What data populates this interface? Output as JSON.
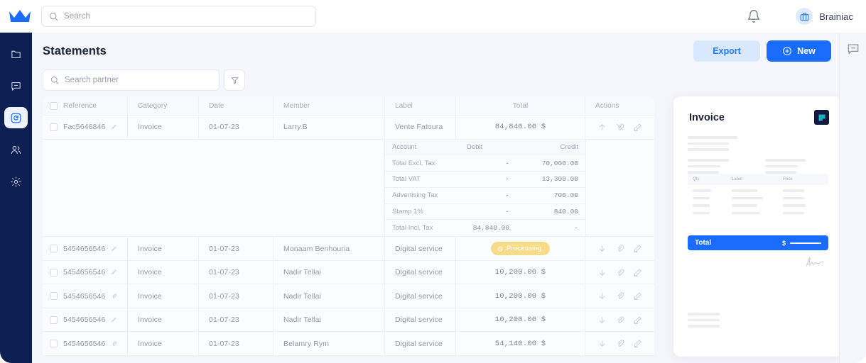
{
  "topbar": {
    "logo": "crown-logo",
    "search_placeholder": "Search",
    "bell": "bell-icon",
    "avatar_icon": "briefcase-icon",
    "user_name": "Brainiac"
  },
  "sidebar": {
    "items": [
      {
        "icon": "folder-icon",
        "active": false
      },
      {
        "icon": "chat-minus-icon",
        "active": false
      },
      {
        "icon": "sync-refresh-icon",
        "active": true
      },
      {
        "icon": "users-icon",
        "active": false
      },
      {
        "icon": "settings-gear-icon",
        "active": false
      }
    ]
  },
  "header": {
    "title": "Statements",
    "export_label": "Export",
    "new_label": "New"
  },
  "toolbar": {
    "search_placeholder": "Search partner",
    "filter_icon": "funnel-filter-icon"
  },
  "table": {
    "columns": [
      "Reference",
      "Category",
      "Date",
      "Member",
      "Label",
      "Total",
      "Actions"
    ],
    "rows": [
      {
        "reference": "Fac5646846",
        "ref_icon": "magic-wand-icon",
        "category": "Invoice",
        "date": "01-07-23",
        "member": "Larry.B",
        "label": "Vente Fatoura",
        "total": "84,840.00 $",
        "status": null,
        "actions": [
          "arrow-up-icon",
          "paperclip-slash-icon",
          "pencil-icon"
        ],
        "expanded": true
      },
      {
        "reference": "5454656546",
        "ref_icon": "magic-wand-icon",
        "category": "Invoice",
        "date": "01-07-23",
        "member": "Monaam Benhouria",
        "label": "Digital service",
        "total": null,
        "status": "Processing",
        "actions": [
          "arrow-down-icon",
          "paperclip-icon",
          "pencil-icon"
        ],
        "expanded": false
      },
      {
        "reference": "5454656546",
        "ref_icon": "magic-wand-icon",
        "category": "Invoice",
        "date": "01-07-23",
        "member": "Nadir Tellai",
        "label": "Digital service",
        "total": "10,200.00 $",
        "status": null,
        "actions": [
          "arrow-down-icon",
          "paperclip-icon",
          "pencil-icon"
        ],
        "expanded": false
      },
      {
        "reference": "5454656546",
        "ref_icon": "paperclip-icon",
        "category": "Invoice",
        "date": "01-07-23",
        "member": "Nadir Tellai",
        "label": "Digital service",
        "total": "10,200.00 $",
        "status": null,
        "actions": [
          "arrow-down-icon",
          "paperclip-icon",
          "pencil-icon"
        ],
        "expanded": false
      },
      {
        "reference": "5454656546",
        "ref_icon": "magic-wand-icon",
        "category": "Invoice",
        "date": "01-07-23",
        "member": "Nadir Tellai",
        "label": "Digital service",
        "total": "10,200.00 $",
        "status": null,
        "actions": [
          "arrow-down-icon",
          "paperclip-icon",
          "pencil-icon"
        ],
        "expanded": false
      },
      {
        "reference": "5454656546",
        "ref_icon": "paperclip-icon",
        "category": "Invoice",
        "date": "01-07-23",
        "member": "Belamry Rym",
        "label": "Digital service",
        "total": "54,140.00 $",
        "status": null,
        "actions": [
          "arrow-down-icon",
          "paperclip-icon",
          "pencil-icon"
        ],
        "expanded": false
      }
    ]
  },
  "subtable": {
    "columns": [
      "Account",
      "Debit",
      "Credit"
    ],
    "rows": [
      {
        "account": "Total Excl. Tax",
        "debit": "-",
        "credit": "70,000.00"
      },
      {
        "account": "Total VAT",
        "debit": "-",
        "credit": "13,300.00"
      },
      {
        "account": "Advertising Tax",
        "debit": "-",
        "credit": "700.00"
      },
      {
        "account": "Stamp 1%",
        "debit": "-",
        "credit": "840.00"
      },
      {
        "account": "Total Incl. Tax",
        "debit": "84,840.00",
        "credit": "-"
      }
    ]
  },
  "invoice_preview": {
    "title": "Invoice",
    "logo": "square-brand-logo",
    "mini_columns": [
      "Qty",
      "Label",
      "Price"
    ],
    "total_label": "Total",
    "currency": "$",
    "signature": "handwritten-signature"
  },
  "right_rail": {
    "chat_icon": "chat-minus-icon"
  },
  "colors": {
    "brand_blue": "#1a6dfc",
    "export_blue_bg": "#d9e7ff",
    "sidebar_navy": "#0c1f52",
    "canvas": "#f4f6fb",
    "badge_yellow": "#f7dd8a",
    "logo_navy": "#131a3d",
    "logo_teal": "#1aaec4"
  }
}
